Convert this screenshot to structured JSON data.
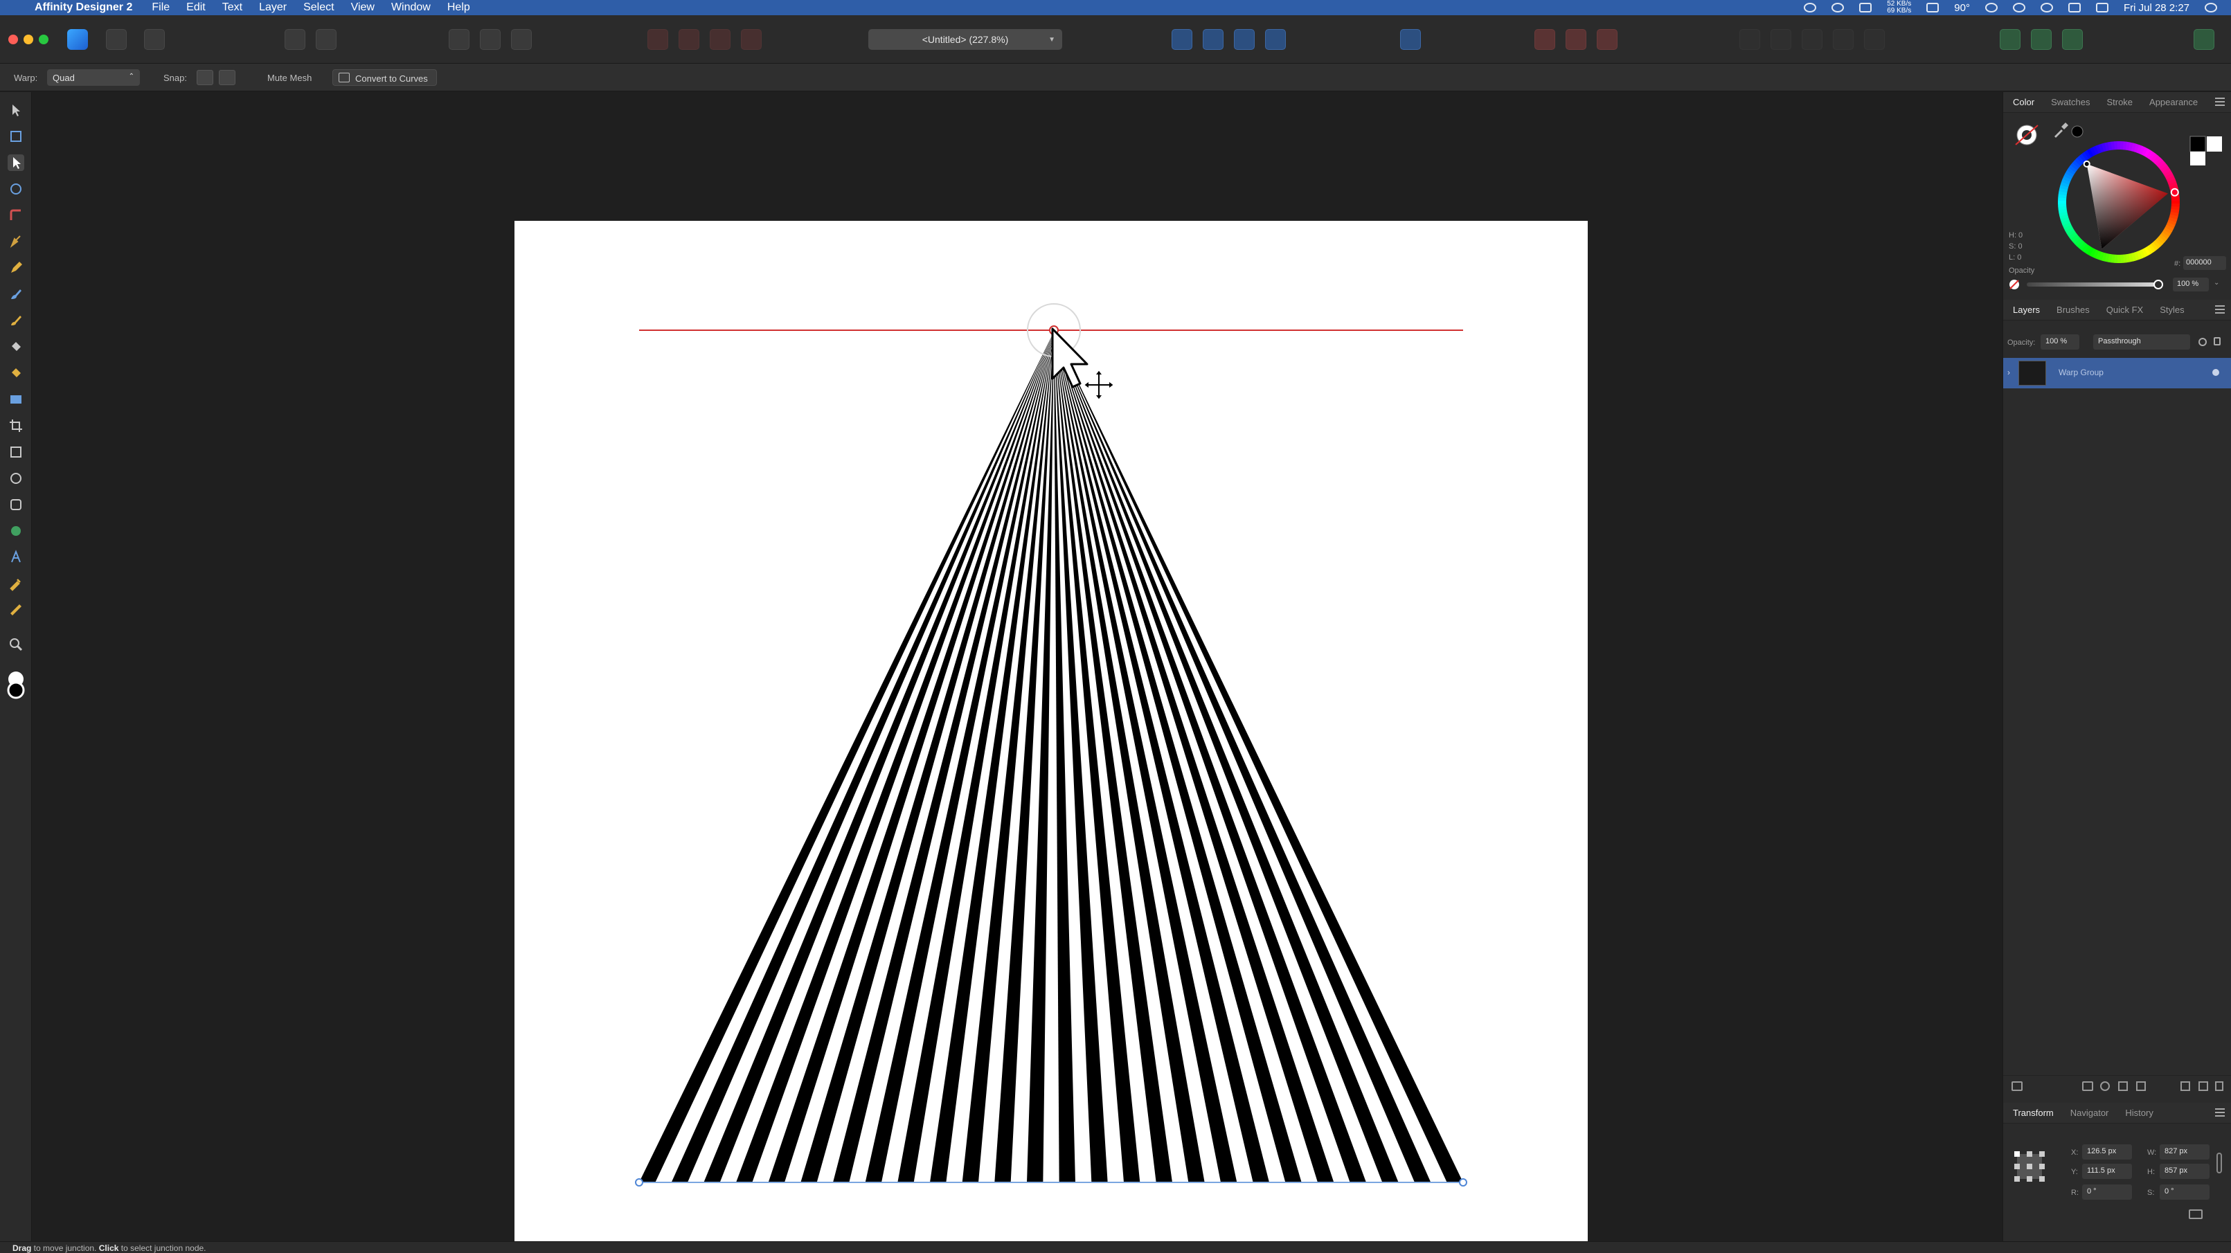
{
  "menubar": {
    "app_name": "Affinity Designer 2",
    "menus": [
      "File",
      "Edit",
      "Text",
      "Layer",
      "Select",
      "View",
      "Window",
      "Help"
    ],
    "clock": "Fri Jul 28  2:27",
    "temperature": "90°",
    "net_up": "52 KB/s",
    "net_down": "69 KB/s"
  },
  "toolbar": {
    "document_title": "<Untitled> (227.8%)"
  },
  "context": {
    "warp_label": "Warp:",
    "warp_value": "Quad",
    "snap_label": "Snap:",
    "mute_mesh_label": "Mute Mesh",
    "convert_label": "Convert to Curves"
  },
  "color_panel": {
    "tabs": [
      "Color",
      "Swatches",
      "Stroke",
      "Appearance"
    ],
    "active_tab": "Color",
    "h_label": "H: 0",
    "s_label": "S: 0",
    "l_label": "L: 0",
    "hex_label": "#:",
    "hex_value": "000000",
    "opacity_label": "Opacity",
    "opacity_value": "100 %",
    "opacity_fraction": 1.0
  },
  "layers_panel": {
    "tabs": [
      "Layers",
      "Brushes",
      "Quick FX",
      "Styles"
    ],
    "active_tab": "Layers",
    "opacity_label": "Opacity:",
    "opacity_value": "100 %",
    "blend_mode": "Passthrough",
    "layers": [
      {
        "name": "Warp Group",
        "selected": true
      }
    ]
  },
  "transform_panel": {
    "tabs": [
      "Transform",
      "Navigator",
      "History"
    ],
    "active_tab": "Transform",
    "x_label": "X:",
    "x_value": "126.5 px",
    "y_label": "Y:",
    "y_value": "111.5 px",
    "w_label": "W:",
    "w_value": "827 px",
    "h_label": "H:",
    "h_value": "857 px",
    "r_label": "R:",
    "r_value": "0 °",
    "s_label": "S:",
    "s_value": "0 °"
  },
  "statusbar": {
    "drag": "Drag",
    "drag_text": " to move junction. ",
    "click": "Click",
    "click_text": " to select junction node."
  },
  "colors": {
    "menubar": "#2f5ea8",
    "selection_blue": "#3b5f9e",
    "guide_red": "#d03030",
    "accent": "#2f8cff"
  },
  "artwork": {
    "stripe_count": 26
  }
}
